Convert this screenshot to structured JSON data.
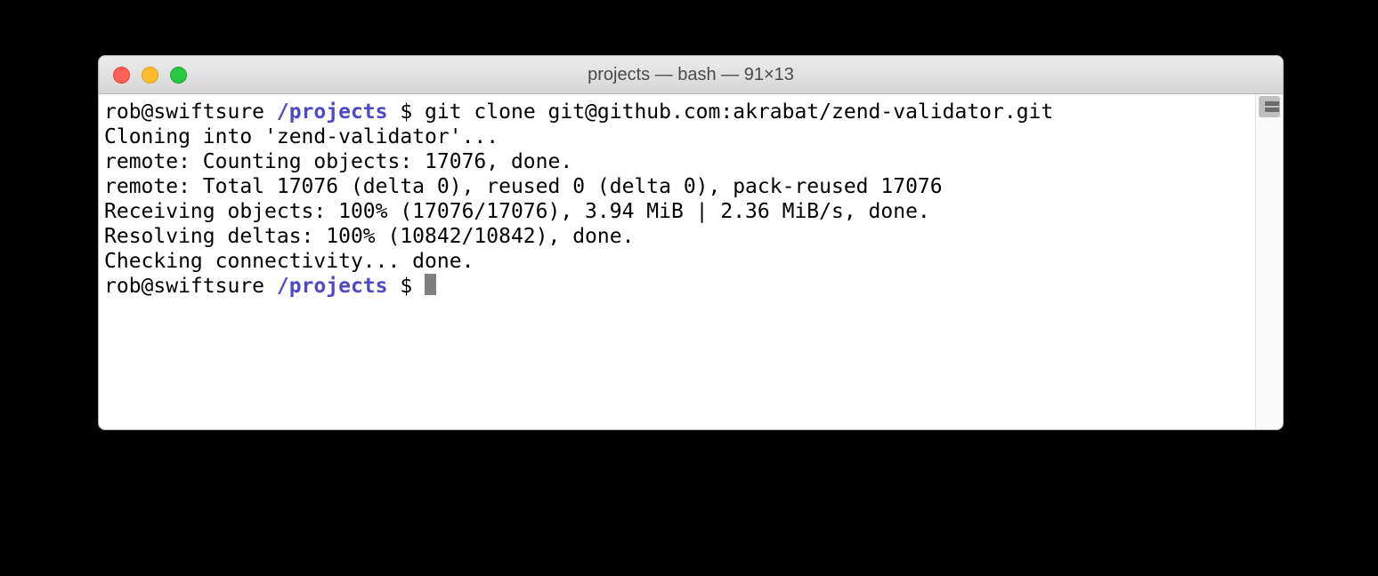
{
  "window": {
    "title": "projects — bash — 91×13"
  },
  "prompt1": {
    "userhost": "rob@swiftsure ",
    "path": "/projects",
    "symbol": " $ ",
    "command": "git clone git@github.com:akrabat/zend-validator.git"
  },
  "output": {
    "l1": "Cloning into 'zend-validator'...",
    "l2": "remote: Counting objects: 17076, done.",
    "l3": "remote: Total 17076 (delta 0), reused 0 (delta 0), pack-reused 17076",
    "l4": "Receiving objects: 100% (17076/17076), 3.94 MiB | 2.36 MiB/s, done.",
    "l5": "Resolving deltas: 100% (10842/10842), done.",
    "l6": "Checking connectivity... done."
  },
  "prompt2": {
    "userhost": "rob@swiftsure ",
    "path": "/projects",
    "symbol": " $ "
  }
}
